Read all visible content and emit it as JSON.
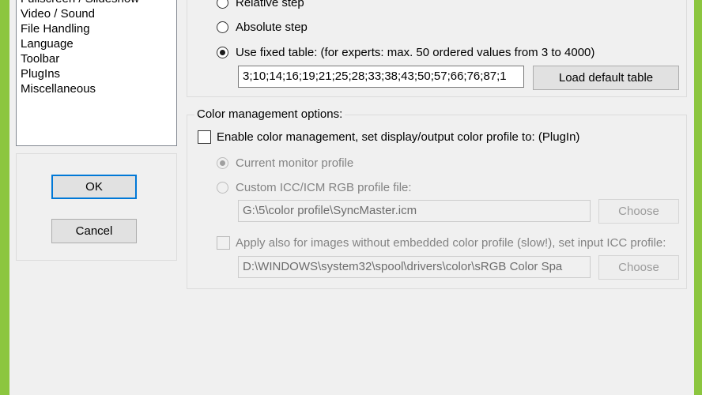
{
  "nav": {
    "items": [
      "Fullscreen / Slideshow",
      "Video / Sound",
      "File Handling",
      "Language",
      "Toolbar",
      "PlugIns",
      "Miscellaneous"
    ]
  },
  "buttons": {
    "ok": "OK",
    "cancel": "Cancel"
  },
  "zoom_group": {
    "relative_step": "Relative step",
    "absolute_step": "Absolute step",
    "fixed_table": "Use fixed table: (for experts: max. 50 ordered values from 3 to 4000)",
    "fixed_table_value": "3;10;14;16;19;21;25;28;33;38;43;50;57;66;76;87;1",
    "load_default": "Load default table"
  },
  "color_group": {
    "title": "Color management options:",
    "enable": "Enable color management, set display/output color profile to: (PlugIn)",
    "current_monitor": "Current monitor profile",
    "custom_icc": "Custom ICC/ICM RGB profile file:",
    "custom_icc_path": "G:\\5\\color profile\\SyncMaster.icm",
    "choose1": "Choose",
    "apply_also": "Apply also for images without embedded color profile (slow!), set input ICC profile:",
    "input_icc_path": "D:\\WINDOWS\\system32\\spool\\drivers\\color\\sRGB Color Spa",
    "choose2": "Choose"
  }
}
